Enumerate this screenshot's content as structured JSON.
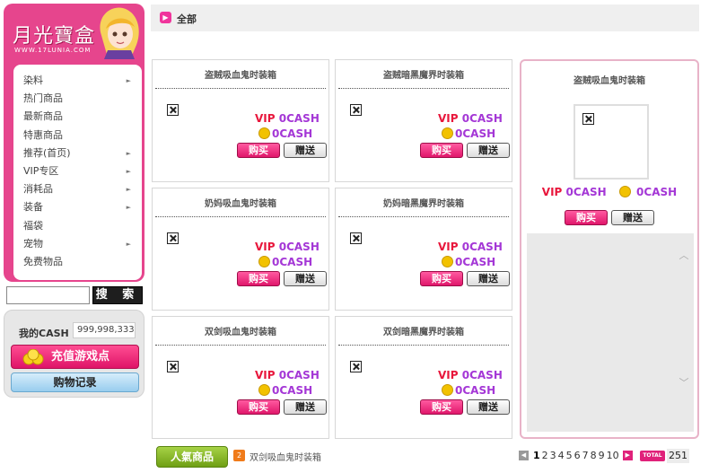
{
  "logo": {
    "title": "月光寶盒",
    "url": "WWW.17LUNIA.COM"
  },
  "menu": {
    "items": [
      {
        "label": "染料",
        "has_sub": true
      },
      {
        "label": "热门商品",
        "has_sub": false
      },
      {
        "label": "最新商品",
        "has_sub": false
      },
      {
        "label": "特惠商品",
        "has_sub": false
      },
      {
        "label": "推荐(首页)",
        "has_sub": true
      },
      {
        "label": "VIP专区",
        "has_sub": true
      },
      {
        "label": "消耗品",
        "has_sub": true
      },
      {
        "label": "装备",
        "has_sub": true
      },
      {
        "label": "福袋",
        "has_sub": false
      },
      {
        "label": "宠物",
        "has_sub": true
      },
      {
        "label": "免费物品",
        "has_sub": false
      }
    ],
    "arrow": "►"
  },
  "search": {
    "value": "",
    "button_label": "搜 索"
  },
  "cash_panel": {
    "label": "我的CASH",
    "value": "999,998,333",
    "recharge_label": "充值游戏点",
    "history_label": "购物记录"
  },
  "header": {
    "title": "全部"
  },
  "products": [
    {
      "title": "盗贼吸血鬼时装箱",
      "vip_label": "VIP",
      "vip_price": "0CASH",
      "price": "0CASH",
      "buy_label": "购买",
      "gift_label": "赠送"
    },
    {
      "title": "盗贼暗黑魔界时装箱",
      "vip_label": "VIP",
      "vip_price": "0CASH",
      "price": "0CASH",
      "buy_label": "购买",
      "gift_label": "赠送"
    },
    {
      "title": "奶妈吸血鬼时装箱",
      "vip_label": "VIP",
      "vip_price": "0CASH",
      "price": "0CASH",
      "buy_label": "购买",
      "gift_label": "赠送"
    },
    {
      "title": "奶妈暗黑魔界时装箱",
      "vip_label": "VIP",
      "vip_price": "0CASH",
      "price": "0CASH",
      "buy_label": "购买",
      "gift_label": "赠送"
    },
    {
      "title": "双剑吸血鬼时装箱",
      "vip_label": "VIP",
      "vip_price": "0CASH",
      "price": "0CASH",
      "buy_label": "购买",
      "gift_label": "赠送"
    },
    {
      "title": "双剑暗黑魔界时装箱",
      "vip_label": "VIP",
      "vip_price": "0CASH",
      "price": "0CASH",
      "buy_label": "购买",
      "gift_label": "赠送"
    }
  ],
  "detail": {
    "title": "盗贼吸血鬼时装箱",
    "vip_label": "VIP",
    "vip_price": "0CASH",
    "price": "0CASH",
    "buy_label": "购买",
    "gift_label": "赠送"
  },
  "bottom": {
    "popular_label": "人氣商品",
    "popular_rank": "2",
    "popular_item": "双剑吸血鬼时装箱"
  },
  "pagination": {
    "pages": [
      "1",
      "2",
      "3",
      "4",
      "5",
      "6",
      "7",
      "8",
      "9",
      "10"
    ],
    "current": "1",
    "total_label": "TOTAL",
    "total": "251"
  },
  "colors": {
    "brand_pink": "#e6458d",
    "vip_red": "#e8173c",
    "price_purple": "#a437d6",
    "popular_green": "#7fae1c"
  },
  "icons": {
    "image_placeholder": "broken-image-icon",
    "coin": "coin-icon",
    "header": "arrow-right-icon",
    "rank": "rank-badge-icon"
  }
}
